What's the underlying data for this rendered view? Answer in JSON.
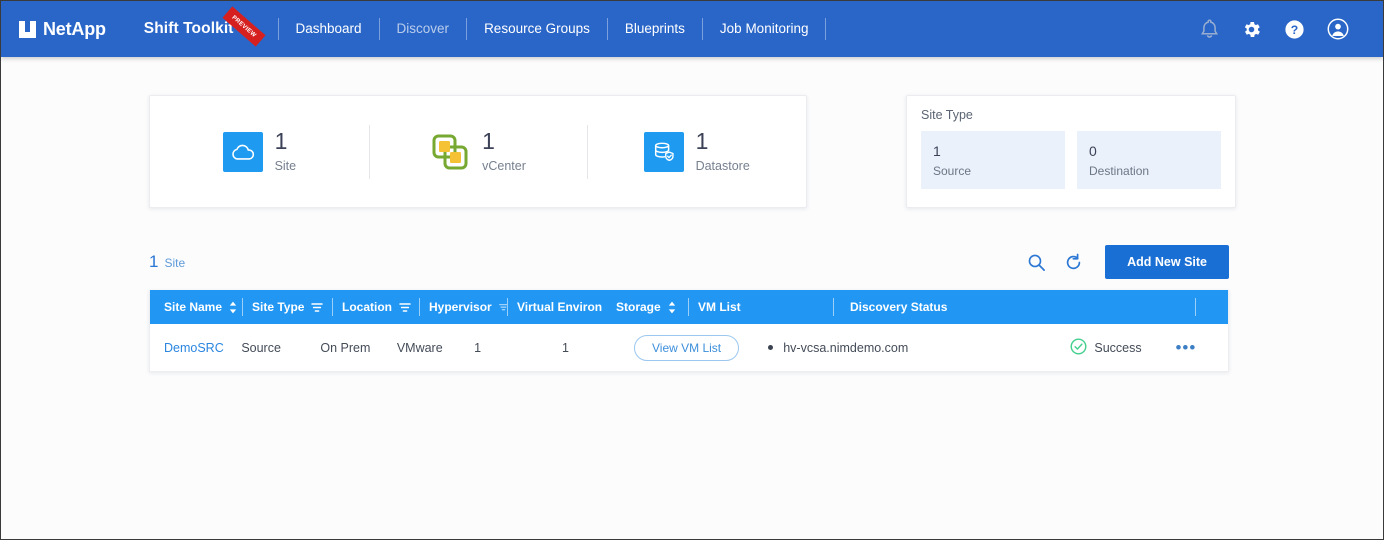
{
  "header": {
    "logo_text": "NetApp",
    "brand_title": "Shift Toolkit",
    "ribbon_text": "PREVIEW",
    "nav_items": [
      {
        "label": "Dashboard",
        "active": false
      },
      {
        "label": "Discover",
        "active": true
      },
      {
        "label": "Resource Groups",
        "active": false
      },
      {
        "label": "Blueprints",
        "active": false
      },
      {
        "label": "Job Monitoring",
        "active": false
      }
    ],
    "icons": [
      "bell-icon",
      "gear-icon",
      "help-icon",
      "user-avatar-icon"
    ]
  },
  "stats_card": {
    "items": [
      {
        "icon": "cloud-icon",
        "value": "1",
        "label": "Site"
      },
      {
        "icon": "vcenter-icon",
        "value": "1",
        "label": "vCenter"
      },
      {
        "icon": "datastore-icon",
        "value": "1",
        "label": "Datastore"
      }
    ]
  },
  "site_type_card": {
    "title": "Site Type",
    "tiles": [
      {
        "value": "1",
        "label": "Source"
      },
      {
        "value": "0",
        "label": "Destination"
      }
    ]
  },
  "toolbar": {
    "count": "1",
    "count_label": "Site",
    "search_icon": "search-icon",
    "refresh_icon": "refresh-icon",
    "add_button_label": "Add New Site"
  },
  "table": {
    "columns": [
      {
        "label": "Site Name",
        "control": "sort"
      },
      {
        "label": "Site Type",
        "control": "filter"
      },
      {
        "label": "Location",
        "control": "filter"
      },
      {
        "label": "Hypervisor",
        "control": "caret"
      },
      {
        "label": "Virtual Environ",
        "control": "none"
      },
      {
        "label": "Storage",
        "control": "sort"
      },
      {
        "label": "VM List",
        "control": "none"
      },
      {
        "label": "Discovery Status",
        "control": "none"
      }
    ],
    "rows": [
      {
        "site_name": "DemoSRC",
        "site_type": "Source",
        "location": "On Prem",
        "hypervisor": "VMware",
        "virtual_environment": "1",
        "storage": "1",
        "vm_list_button": "View VM List",
        "discovery_host": "hv-vcsa.nimdemo.com",
        "status": "Success",
        "more_menu": "•••"
      }
    ]
  },
  "colors": {
    "nav_blue": "#2a66c8",
    "table_header_blue": "#2196f3",
    "accent_blue": "#1a6fd4",
    "link_blue": "#2a86e0",
    "success_green": "#44cf8e",
    "tile_blue": "#eaf1fb"
  }
}
